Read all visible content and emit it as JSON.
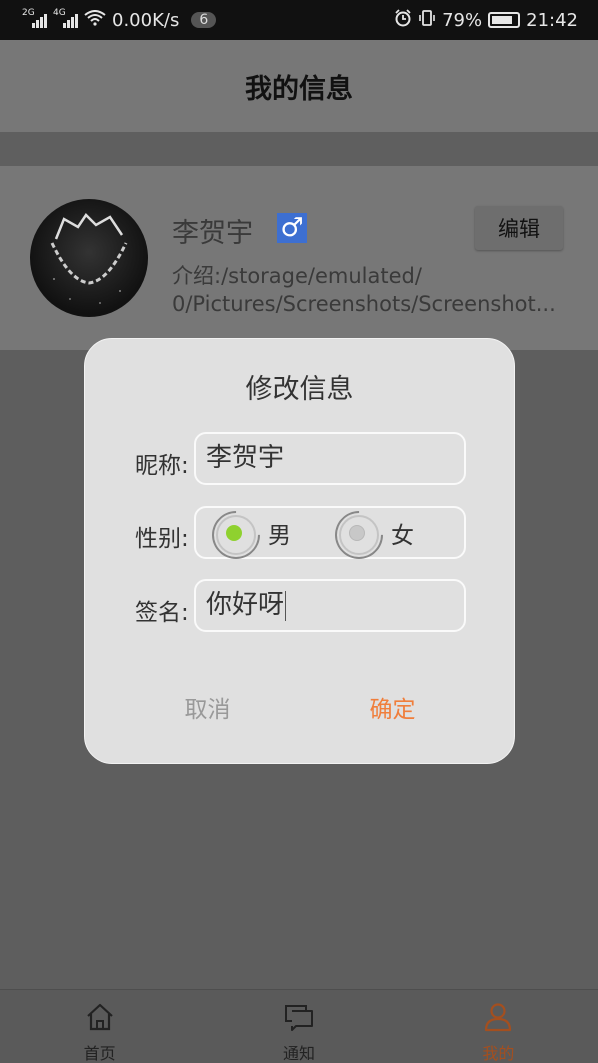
{
  "status_bar": {
    "network_1": "2G",
    "network_2": "4G",
    "speed": "0.00K/s",
    "notification_count": "6",
    "battery": "79%",
    "time": "21:42"
  },
  "header": {
    "title": "我的信息"
  },
  "profile": {
    "name": "李贺宇",
    "gender_symbol": "♂",
    "edit_label": "编辑",
    "intro_line1": "介绍:/storage/emulated/",
    "intro_line2": "0/Pictures/Screenshots/Screenshot..."
  },
  "dialog": {
    "title": "修改信息",
    "nickname_label": "昵称:",
    "nickname_value": "李贺宇",
    "gender_label": "性别:",
    "gender_options": [
      {
        "label": "男",
        "selected": true
      },
      {
        "label": "女",
        "selected": false
      }
    ],
    "signature_label": "签名:",
    "signature_value": "你好呀",
    "cancel_label": "取消",
    "confirm_label": "确定"
  },
  "bottom_nav": {
    "items": [
      {
        "label": "首页",
        "icon": "home-icon",
        "active": false
      },
      {
        "label": "通知",
        "icon": "notification-icon",
        "active": false
      },
      {
        "label": "我的",
        "icon": "person-icon",
        "active": true
      }
    ]
  },
  "colors": {
    "accent": "#f07e3b",
    "radio_selected": "#8fd12f",
    "gender_badge": "#3d6fd1",
    "overlay": "#5e5e5e"
  }
}
